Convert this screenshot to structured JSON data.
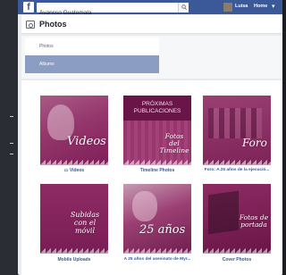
{
  "topbar": {
    "logo": "f",
    "search_value": "Avancso Guatemala",
    "user_name": "Luisa",
    "home_label": "Home"
  },
  "header": {
    "title": "Photos"
  },
  "tabs": [
    {
      "label": "Photos"
    },
    {
      "label": "Albums"
    }
  ],
  "albums": [
    {
      "caption": "Videos",
      "cover_text": "Videos",
      "has_video_icon": true
    },
    {
      "caption": "Timeline Photos",
      "cover_text": "Fotos del Timeline",
      "banner": "PRÓXIMAS PUBLICACIONES"
    },
    {
      "caption": "Foro: A 25 años de la ejecució...",
      "cover_text": "Foro"
    },
    {
      "caption": "Mobile Uploads",
      "cover_text": "Subidas con el móvil"
    },
    {
      "caption": "A 25 años del asesinato de Myr...",
      "cover_text": "25 años"
    },
    {
      "caption": "Cover Photos",
      "cover_text": "Fotos de portada"
    }
  ],
  "colors": {
    "facebook_blue": "#3b5998",
    "album_overlay": "#8e1d5e",
    "selected_tab": "#8b9dc3"
  }
}
